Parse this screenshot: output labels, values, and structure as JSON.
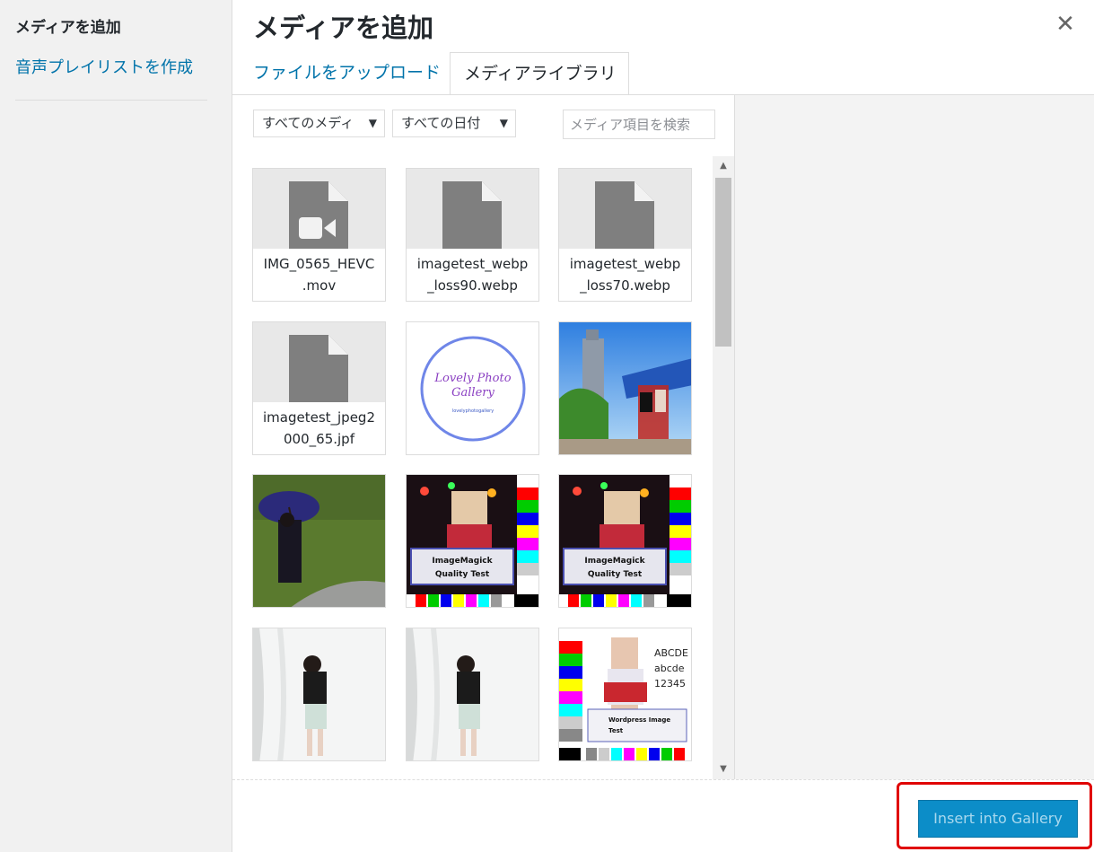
{
  "menu": {
    "title": "メディアを追加",
    "playlist_link": "音声プレイリストを作成"
  },
  "header": {
    "title": "メディアを追加",
    "close_symbol": "✕"
  },
  "tabs": [
    {
      "label": "ファイルをアップロード",
      "active": false
    },
    {
      "label": "メディアライブラリ",
      "active": true
    }
  ],
  "toolbar": {
    "type_filter": "すべてのメディ",
    "date_filter": "すべての日付",
    "caret": "▼",
    "search_placeholder": "メディア項目を検索"
  },
  "attachments": [
    {
      "kind": "video",
      "filename": "IMG_0565_HEVC\n.mov"
    },
    {
      "kind": "file",
      "filename": "imagetest_webp\n_loss90.webp"
    },
    {
      "kind": "file",
      "filename": "imagetest_webp\n_loss70.webp"
    },
    {
      "kind": "file",
      "filename": "imagetest_jpeg2\n000_65.jpf"
    },
    {
      "kind": "image",
      "thumb": "logo",
      "logo_text_1": "Lovely Photo",
      "logo_text_2": "Gallery",
      "logo_small": "lovelyphotogallery"
    },
    {
      "kind": "image",
      "thumb": "tower"
    },
    {
      "kind": "image",
      "thumb": "umbrella"
    },
    {
      "kind": "image",
      "thumb": "quality",
      "caption_1": "ImageMagick",
      "caption_2": "Quality Test"
    },
    {
      "kind": "image",
      "thumb": "quality",
      "caption_1": "ImageMagick",
      "caption_2": "Quality Test"
    },
    {
      "kind": "image",
      "thumb": "tunnel"
    },
    {
      "kind": "image",
      "thumb": "tunnel"
    },
    {
      "kind": "image",
      "thumb": "wptest",
      "text_1": "ABCDE",
      "text_2": "abcde",
      "text_3": "12345",
      "caption_1": "Wordpress Image",
      "caption_2": "Test"
    }
  ],
  "scrollbar": {
    "up": "▲",
    "down": "▼"
  },
  "footer": {
    "insert_button": "Insert into Gallery"
  },
  "colors": {
    "link": "#0073aa",
    "primary_button": "#0c8dc8",
    "highlight": "#e00000"
  }
}
